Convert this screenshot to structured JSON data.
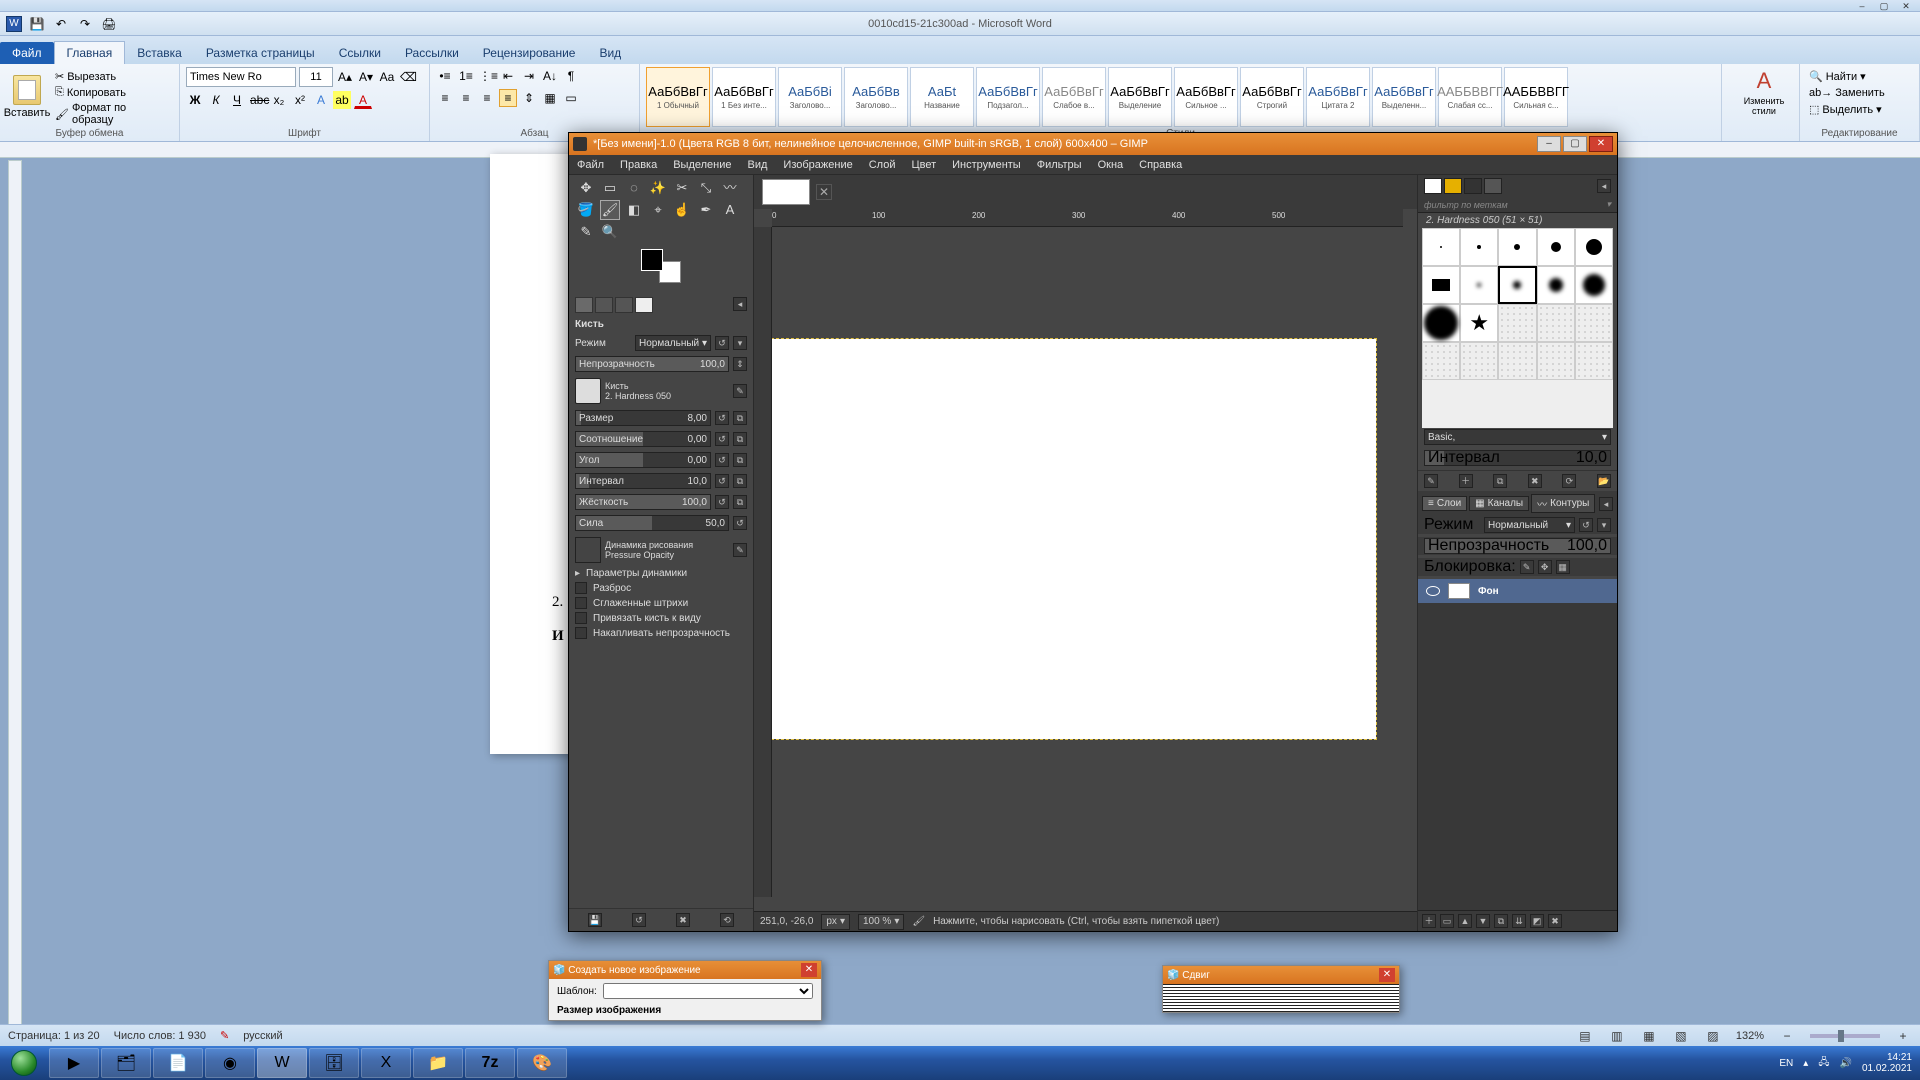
{
  "word": {
    "title": "0010cd15-21c300ad - Microsoft Word",
    "tabs": [
      "Файл",
      "Главная",
      "Вставка",
      "Разметка страницы",
      "Ссылки",
      "Рассылки",
      "Рецензирование",
      "Вид"
    ],
    "active_tab_index": 1,
    "clipboard": {
      "paste": "Вставить",
      "cut": "Вырезать",
      "copy": "Копировать",
      "format_painter": "Формат по образцу",
      "label": "Буфер обмена"
    },
    "font": {
      "name": "Times New Ro",
      "size": "11",
      "label": "Шрифт"
    },
    "paragraph": {
      "label": "Абзац"
    },
    "styles": {
      "label": "Стили",
      "items": [
        {
          "prev": "АаБбВвГг",
          "name": "1 Обычный",
          "color": "#000"
        },
        {
          "prev": "АаБбВвГг",
          "name": "1 Без инте...",
          "color": "#000"
        },
        {
          "prev": "АаБбВі",
          "name": "Заголово...",
          "color": "#2a5a9a"
        },
        {
          "prev": "АаБбВв",
          "name": "Заголово...",
          "color": "#2a5a9a"
        },
        {
          "prev": "АаБt",
          "name": "Название",
          "color": "#2a5a9a"
        },
        {
          "prev": "АаБбВвГг",
          "name": "Подзагол...",
          "color": "#2a5a9a"
        },
        {
          "prev": "АаБбВвГг",
          "name": "Слабое в...",
          "color": "#888"
        },
        {
          "prev": "АаБбВвГг",
          "name": "Выделение",
          "color": "#000"
        },
        {
          "prev": "АаБбВвГг",
          "name": "Сильное ...",
          "color": "#000"
        },
        {
          "prev": "АаБбВвГг",
          "name": "Строгий",
          "color": "#000"
        },
        {
          "prev": "АаБбВвГг",
          "name": "Цитата 2",
          "color": "#2a5a9a"
        },
        {
          "prev": "АаБбВвГг",
          "name": "Выделенн...",
          "color": "#2a5a9a"
        },
        {
          "prev": "ААББВВГГ",
          "name": "Слабая сс...",
          "color": "#888"
        },
        {
          "prev": "ААББВВГГ",
          "name": "Сильная с...",
          "color": "#000"
        }
      ],
      "change": "Изменить стили"
    },
    "editing": {
      "find": "Найти",
      "replace": "Заменить",
      "select": "Выделить",
      "label": "Редактирование"
    },
    "doc": {
      "line1": "2.",
      "line2": "И"
    },
    "status": {
      "page": "Страница: 1 из 20",
      "words": "Число слов: 1 930",
      "lang": "русский",
      "zoom": "132%"
    }
  },
  "gimp": {
    "title": "*[Без имени]-1.0 (Цвета RGB 8 бит, нелинейное целочисленное, GIMP built-in sRGB, 1 слой) 600x400 – GIMP",
    "menu": [
      "Файл",
      "Правка",
      "Выделение",
      "Вид",
      "Изображение",
      "Слой",
      "Цвет",
      "Инструменты",
      "Фильтры",
      "Окна",
      "Справка"
    ],
    "ruler_ticks": [
      "0",
      "100",
      "200",
      "300",
      "400",
      "500"
    ],
    "brush_options": {
      "title": "Кисть",
      "mode_label": "Режим",
      "mode_value": "Нормальный",
      "opacity_label": "Непрозрачность",
      "opacity_value": "100,0",
      "brush_label": "Кисть",
      "brush_name": "2. Hardness 050",
      "size_label": "Размер",
      "size_value": "8,00",
      "ratio_label": "Соотношение",
      "ratio_value": "0,00",
      "angle_label": "Угол",
      "angle_value": "0,00",
      "spacing_label": "Интервал",
      "spacing_value": "10,0",
      "hardness_label": "Жёсткость",
      "hardness_value": "100,0",
      "force_label": "Сила",
      "force_value": "50,0",
      "dynamics_label": "Динамика рисования",
      "dynamics_value": "Pressure Opacity",
      "dyn_params": "Параметры динамики",
      "scatter": "Разброс",
      "smooth": "Сглаженные штрихи",
      "lock_view": "Привязать кисть к виду",
      "accumulate": "Накапливать непрозрачность"
    },
    "right": {
      "filter_placeholder": "фильтр по меткам",
      "brush_name": "2. Hardness 050 (51 × 51)",
      "preset_label": "Basic,",
      "spacing_label": "Интервал",
      "spacing_value": "10,0",
      "layers_tab": "Слои",
      "channels_tab": "Каналы",
      "paths_tab": "Контуры",
      "mode_label": "Режим",
      "mode_value": "Нормальный",
      "opacity_label": "Непрозрачность",
      "opacity_value": "100,0",
      "lock_label": "Блокировка:",
      "layer_name": "Фон"
    },
    "status": {
      "coords": "251,0, -26,0",
      "unit": "px",
      "zoom": "100 %",
      "hint": "Нажмите, чтобы нарисовать (Ctrl, чтобы взять пипеткой цвет)"
    }
  },
  "dialog_new": {
    "title": "Создать новое изображение",
    "template": "Шаблон:",
    "size": "Размер изображения"
  },
  "dialog_shift": {
    "title": "Сдвиг"
  },
  "taskbar": {
    "lang": "EN",
    "time": "14:21",
    "date": "01.02.2021"
  }
}
